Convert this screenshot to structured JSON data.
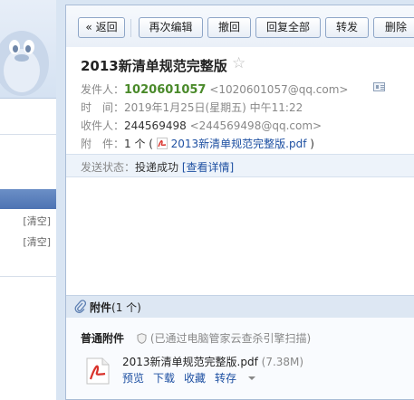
{
  "sidebar": {
    "clear_labels": [
      "[清空]",
      "[清空]"
    ]
  },
  "toolbar": {
    "back": "« 返回",
    "edit_again": "再次编辑",
    "recall": "撤回",
    "reply_all": "回复全部",
    "forward": "转发",
    "delete": "删除"
  },
  "mail": {
    "subject": "2013新清单规范完整版",
    "sender_label": "发件人：",
    "sender_name": "1020601057",
    "sender_addr": "<1020601057@qq.com>",
    "time_label": "时　间：",
    "time_value": "2019年1月25日(星期五) 中午11:22",
    "to_label": "收件人：",
    "to_name": "244569498",
    "to_addr": "<244569498@qq.com>",
    "att_label": "附　件：",
    "att_count": "1 个 (",
    "att_name": "2013新清单规范完整版.pdf",
    "att_close": ")"
  },
  "status": {
    "label": "发送状态：",
    "value": "投递成功",
    "details": "[查看详情]"
  },
  "attachments": {
    "title": "附件",
    "count": "(1 个)",
    "kind": "普通附件",
    "scan_note": "(已通过电脑管家云查杀引擎扫描)",
    "file_name": "2013新清单规范完整版.pdf",
    "file_size": "(7.38M)",
    "preview": "预览",
    "download": "下载",
    "save": "收藏",
    "forward": "转存"
  },
  "colors": {
    "sender": "#4a8a2a",
    "link": "#1e50a2",
    "pdf_red": "#d9322b"
  }
}
